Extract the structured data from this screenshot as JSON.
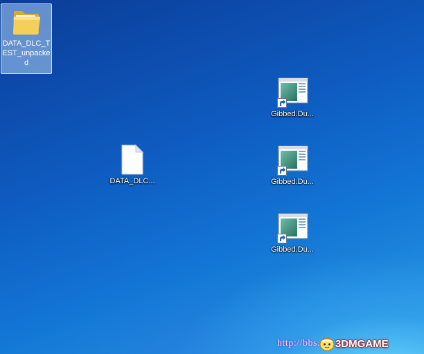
{
  "desktop": {
    "icons": [
      {
        "label": "DATA_DLC_TEST_unpacked",
        "icon": "folder-icon",
        "selected": true
      },
      {
        "label": "DATA_DLC...",
        "icon": "blank-file-icon"
      },
      {
        "label": "Gibbed.Du...",
        "icon": "app-shortcut-icon"
      },
      {
        "label": "Gibbed.Du...",
        "icon": "app-shortcut-icon"
      },
      {
        "label": "Gibbed.Du...",
        "icon": "app-shortcut-icon"
      }
    ]
  },
  "watermark": {
    "url_text": "http://bbs.",
    "brand_text": "3DMGAME"
  },
  "colors": {
    "selection": "#afd2f5",
    "label_text": "#ffffff",
    "brand_outline": "#a01010"
  }
}
